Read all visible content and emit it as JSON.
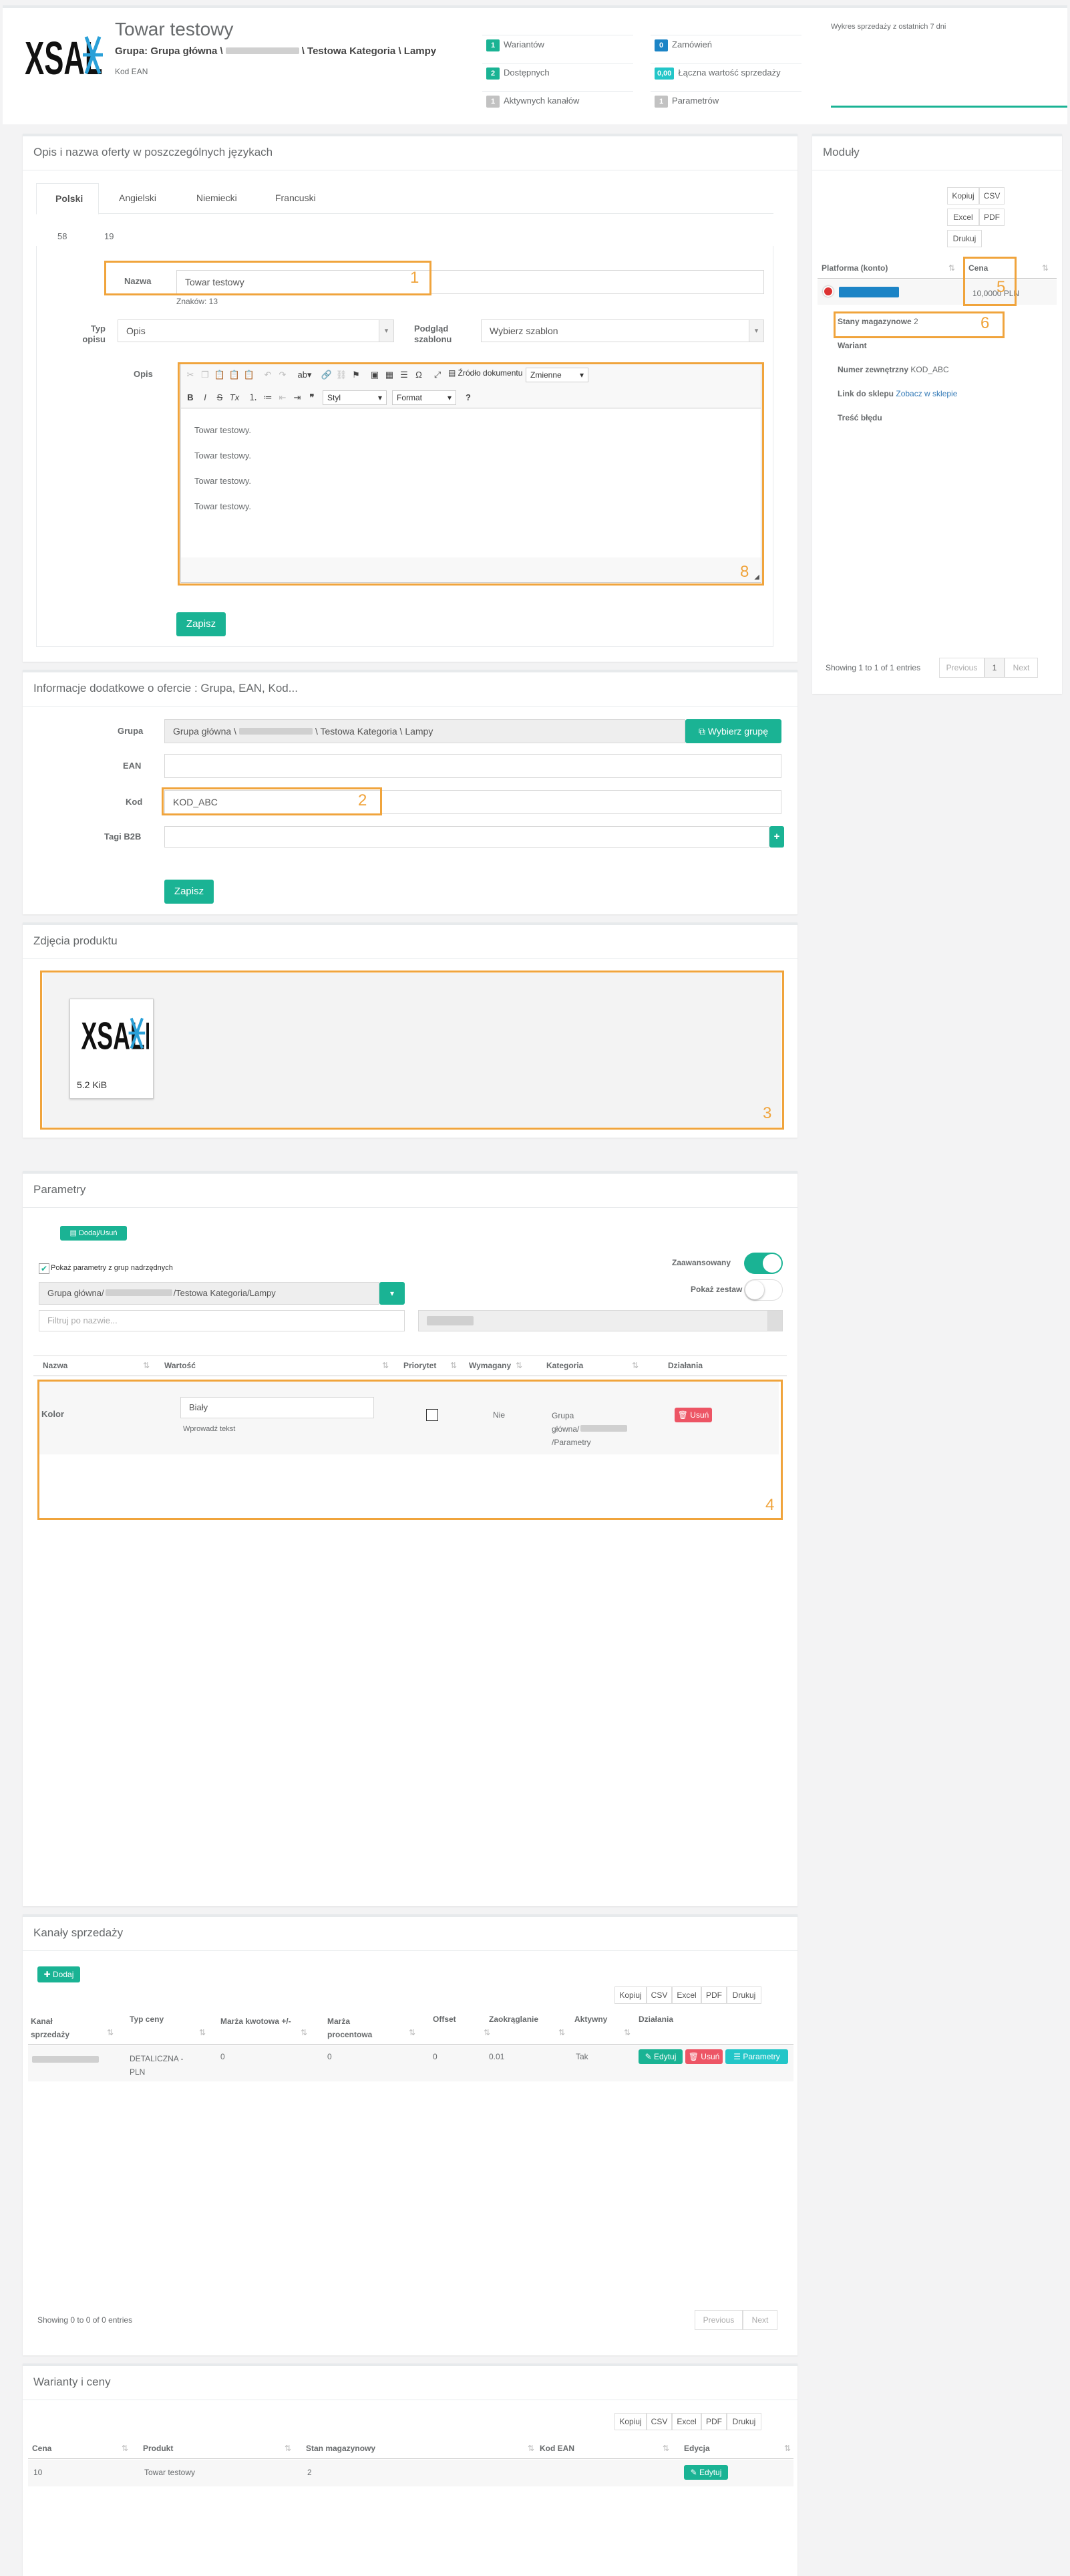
{
  "header": {
    "logo_text": "XSALE",
    "title": "Towar testowy",
    "group_label": "Grupa: Grupa główna \\",
    "group_suffix": "\\ Testowa Kategoria \\ Lampy",
    "ean_label": "Kod EAN",
    "stats": [
      {
        "count": "1",
        "label": "Wariantów",
        "color": "#1ab394"
      },
      {
        "count": "2",
        "label": "Dostępnych",
        "color": "#1ab394"
      },
      {
        "count": "1",
        "label": "Aktywnych kanałów",
        "color": "#c2c2c2"
      },
      {
        "count": "0",
        "label": "Zamówień",
        "color": "#1c84c6"
      },
      {
        "count": "0,00",
        "label": "Łączna wartość sprzedaży",
        "color": "#23c6c8"
      },
      {
        "count": "1",
        "label": "Parametrów",
        "color": "#c2c2c2"
      }
    ],
    "sales_chart_label": "Wykres sprzedaży z ostatnich 7 dni"
  },
  "desc": {
    "title": "Opis i nazwa oferty w poszczególnych językach",
    "tabs": [
      "Polski",
      "Angielski",
      "Niemiecki",
      "Francuski"
    ],
    "counters": [
      "58",
      "19"
    ],
    "name_label": "Nazwa",
    "name_value": "Towar testowy",
    "chars": "Znaków: 13",
    "type_label": "Typ opisu",
    "type_value": "Opis",
    "preview_label": "Podgląd szablonu",
    "preview_value": "Wybierz szablon",
    "opis_label": "Opis",
    "source_btn": "Źródło dokumentu",
    "vars": "Zmienne",
    "style": "Styl",
    "format": "Format",
    "lines": [
      "Towar testowy.",
      "Towar testowy.",
      "Towar testowy.",
      "Towar testowy."
    ],
    "save": "Zapisz"
  },
  "info": {
    "title": "Informacje dodatkowe o ofercie : Grupa, EAN, Kod...",
    "group_label": "Grupa",
    "group_prefix": "Grupa główna \\",
    "group_suffix": "\\ Testowa Kategoria \\ Lampy",
    "choose_btn": "Wybierz grupę",
    "ean_label": "EAN",
    "code_label": "Kod",
    "code_value": "KOD_ABC",
    "tags_label": "Tagi B2B",
    "save": "Zapisz"
  },
  "photos": {
    "title": "Zdjęcia produktu",
    "size": "5.2 KiB"
  },
  "params": {
    "title": "Parametry",
    "add_btn": "Dodaj/Usuń",
    "show_parent": "Pokaż parametry z grup nadrzędnych",
    "advanced": "Zaawansowany",
    "show_sets": "Pokaż zestaw",
    "group_prefix": "Grupa główna/",
    "group_suffix": "/Testowa Kategoria/Lampy",
    "filter_ph": "Filtruj po nazwie...",
    "cols": [
      "Nazwa",
      "Wartość",
      "Priorytet",
      "Wymagany",
      "Kategoria",
      "Działania"
    ],
    "row": {
      "name": "Kolor",
      "value": "Biały",
      "hint": "Wprowadź tekst",
      "required": "Nie",
      "cat1": "Grupa",
      "cat2": "główna/",
      "cat3": "/Parametry",
      "delete": "Usuń"
    }
  },
  "channels": {
    "title": "Kanały sprzedaży",
    "add_btn": "Dodaj",
    "dt_btns": [
      "Kopiuj",
      "CSV",
      "Excel",
      "PDF",
      "Drukuj"
    ],
    "cols": [
      "Kanał sprzedaży",
      "Typ ceny",
      "Marża kwotowa +/-",
      "Marża procentowa",
      "Offset",
      "Zaokrąglanie",
      "Aktywny",
      "Działania"
    ],
    "row": {
      "price_type": "DETALICZNA - PLN",
      "m1": "0",
      "m2": "0",
      "offset": "0",
      "round": "0.01",
      "active": "Tak",
      "edit": "Edytuj",
      "delete": "Usuń",
      "params": "Parametry"
    },
    "info": "Showing 0 to 0 of 0 entries",
    "prev": "Previous",
    "next": "Next"
  },
  "variants": {
    "title": "Warianty i ceny",
    "dt_btns": [
      "Kopiuj",
      "CSV",
      "Excel",
      "PDF",
      "Drukuj"
    ],
    "cols": [
      "Cena",
      "Produkt",
      "Stan magazynowy",
      "Kod EAN",
      "Edycja"
    ],
    "row": {
      "price": "10",
      "product": "Towar testowy",
      "stock": "2",
      "edit": "Edytuj"
    }
  },
  "modules": {
    "title": "Moduły",
    "dt_btns": [
      "Kopiuj",
      "CSV",
      "Excel",
      "PDF",
      "Drukuj"
    ],
    "col_platform": "Platforma (konto)",
    "col_price": "Cena",
    "price": "10,0000 PLN",
    "stock_label": "Stany magazynowe",
    "stock_value": "2",
    "variant_label": "Wariant",
    "ext_label": "Numer zewnętrzny",
    "ext_value": "KOD_ABC",
    "link_label": "Link do sklepu",
    "link_value": "Zobacz w sklepie",
    "err_label": "Treść błędu",
    "info": "Showing 1 to 1 of 1 entries",
    "prev": "Previous",
    "page": "1",
    "next": "Next"
  },
  "annotations": [
    "1",
    "2",
    "3",
    "4",
    "5",
    "6",
    "8"
  ]
}
